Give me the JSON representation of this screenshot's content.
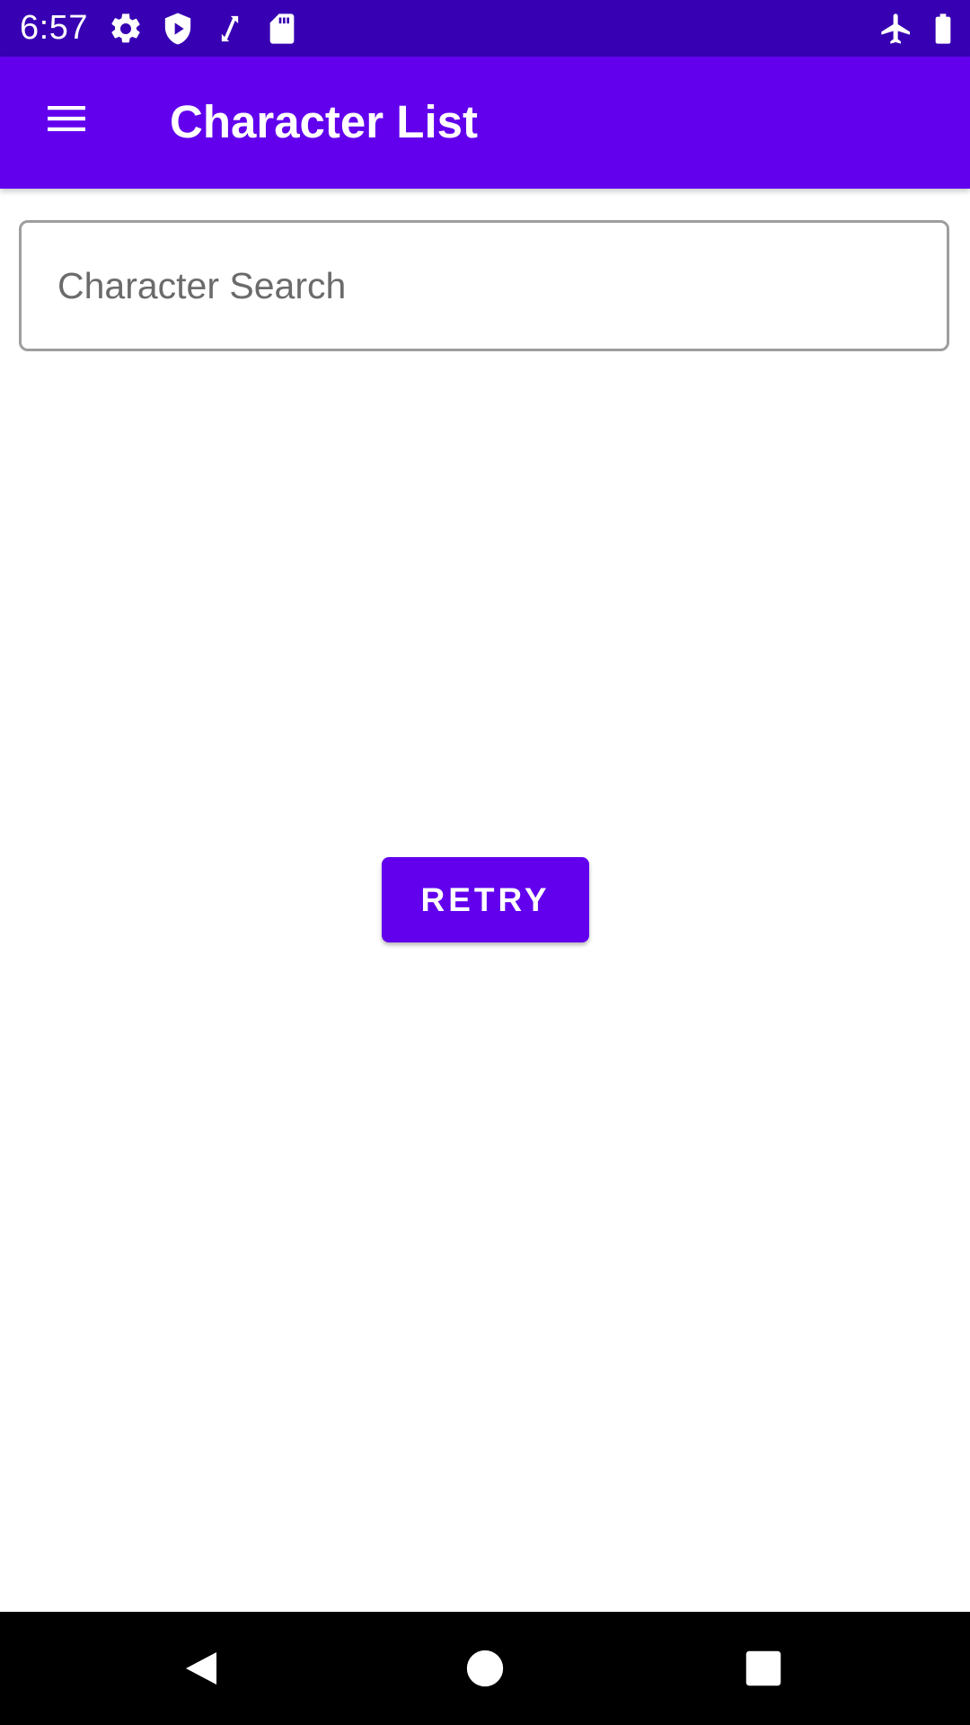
{
  "status_bar": {
    "time": "6:57",
    "left_icons": [
      "gear-icon",
      "play-protect-icon",
      "sync-arrows-icon",
      "sd-card-icon"
    ],
    "right_icons": [
      "airplane-mode-icon",
      "battery-icon"
    ],
    "background_color": "#3700b3"
  },
  "app_bar": {
    "title": "Character List",
    "menu_icon": "hamburger-menu-icon",
    "background_color": "#6200ee"
  },
  "search": {
    "placeholder": "Character Search",
    "value": ""
  },
  "retry_button": {
    "label": "RETRY",
    "background_color": "#6200ee"
  },
  "nav_bar": {
    "buttons": [
      "back-icon",
      "home-icon",
      "recents-icon"
    ]
  }
}
